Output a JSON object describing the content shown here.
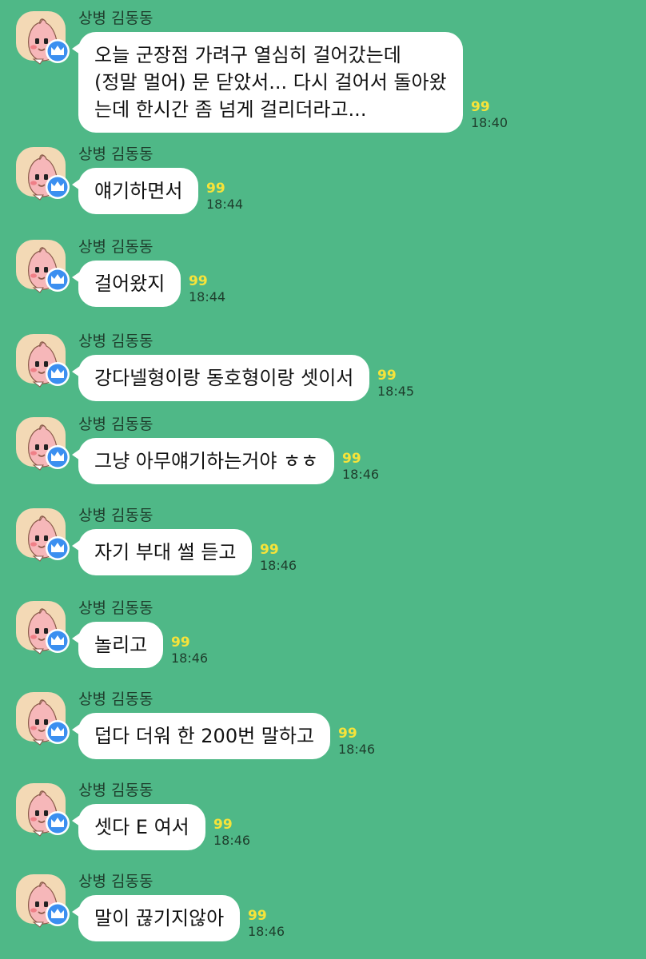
{
  "sender_name": "상병 김동동",
  "colors": {
    "background": "#4fb887",
    "bubble": "#ffffff",
    "unread": "#f6e33a",
    "avatar_bg": "#f3d9b5",
    "crown_badge": "#3b8ff0"
  },
  "icons": {
    "avatar": "apeach-peach-character-icon",
    "badge": "crown-icon"
  },
  "messages": [
    {
      "text": "오늘 군장점 가려구 열심히 걸어갔는데\n(정말 멀어) 문 닫았서... 다시 걸어서 돌아왔\n는데 한시간 좀 넘게 걸리더라고...",
      "unread": "99",
      "time": "18:40"
    },
    {
      "text": "얘기하면서",
      "unread": "99",
      "time": "18:44"
    },
    {
      "text": "걸어왔지",
      "unread": "99",
      "time": "18:44"
    },
    {
      "text": "강다넬형이랑 동호형이랑 셋이서",
      "unread": "99",
      "time": "18:45"
    },
    {
      "text": "그냥 아무얘기하는거야 ㅎㅎ",
      "unread": "99",
      "time": "18:46"
    },
    {
      "text": "자기 부대 썰 듣고",
      "unread": "99",
      "time": "18:46"
    },
    {
      "text": "놀리고",
      "unread": "99",
      "time": "18:46"
    },
    {
      "text": "덥다 더워 한 200번 말하고",
      "unread": "99",
      "time": "18:46"
    },
    {
      "text": "셋다 E 여서",
      "unread": "99",
      "time": "18:46"
    },
    {
      "text": "말이 끊기지않아",
      "unread": "99",
      "time": "18:46"
    }
  ]
}
